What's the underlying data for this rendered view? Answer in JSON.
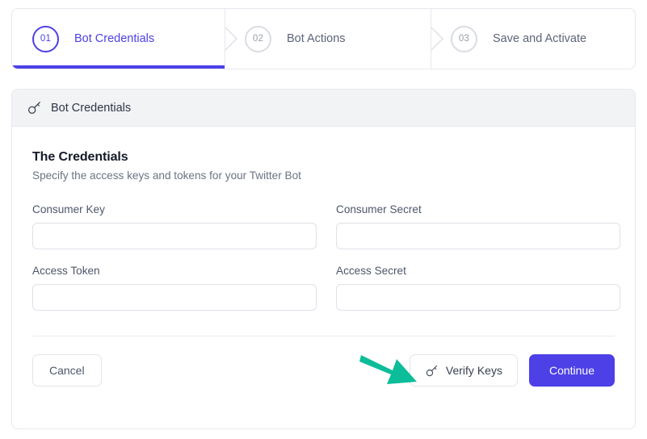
{
  "stepper": {
    "steps": [
      {
        "number": "01",
        "label": "Bot Credentials",
        "state": "active"
      },
      {
        "number": "02",
        "label": "Bot Actions",
        "state": "inactive"
      },
      {
        "number": "03",
        "label": "Save and Activate",
        "state": "inactive"
      }
    ]
  },
  "panel": {
    "header": {
      "icon": "key-icon",
      "title": "Bot Credentials"
    },
    "section": {
      "title": "The Credentials",
      "subtitle": "Specify the access keys and tokens for your Twitter Bot"
    },
    "fields": [
      {
        "label": "Consumer Key",
        "value": "",
        "placeholder": ""
      },
      {
        "label": "Consumer Secret",
        "value": "",
        "placeholder": ""
      },
      {
        "label": "Access Token",
        "value": "",
        "placeholder": ""
      },
      {
        "label": "Access Secret",
        "value": "",
        "placeholder": ""
      }
    ],
    "footer": {
      "cancel_label": "Cancel",
      "verify_label": "Verify Keys",
      "verify_icon": "key-icon",
      "continue_label": "Continue"
    }
  },
  "annotation": {
    "arrow": "arrow-pointing-to-verify-keys",
    "color": "#0cbd99"
  },
  "colors": {
    "accent": "#4d40e6",
    "arrow": "#0cbd99",
    "panel_header_bg": "#f2f3f5",
    "border": "#e6e8ee",
    "text_primary": "#141a28",
    "text_muted": "#6b7383"
  }
}
